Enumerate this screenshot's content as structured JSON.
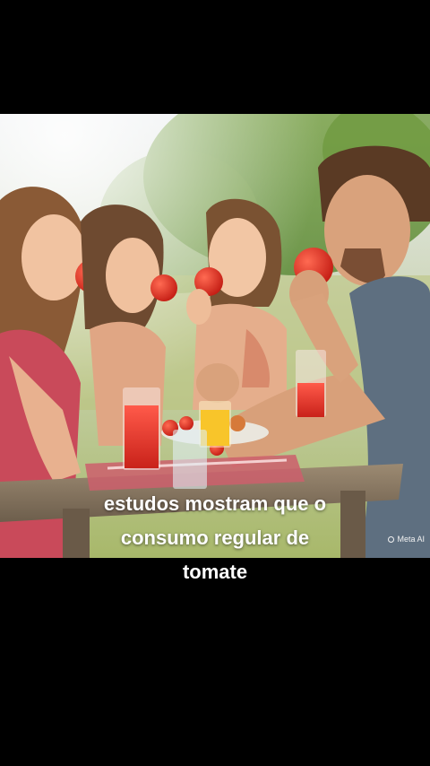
{
  "video": {
    "scene_icon": "picnic-tomato-photo",
    "caption_lines": [
      "estudos mostram que o",
      "consumo regular de",
      "tomate"
    ],
    "watermark": "Meta AI"
  },
  "colors": {
    "background": "#000000",
    "caption_text": "#ffffff"
  }
}
